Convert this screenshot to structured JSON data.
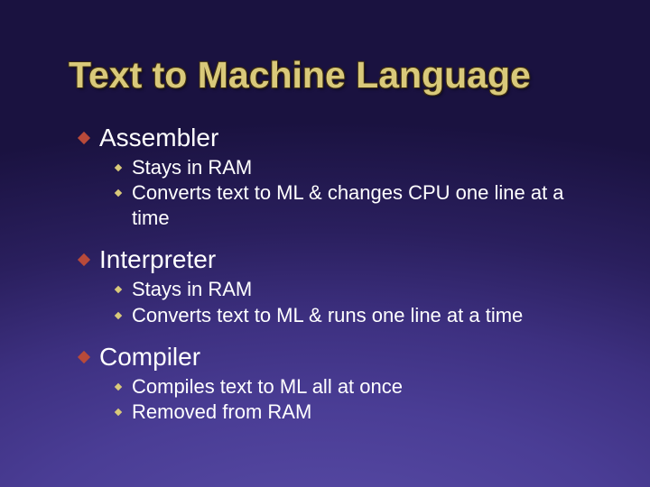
{
  "title": "Text to Machine Language",
  "items": [
    {
      "label": "Assembler",
      "subs": [
        "Stays in RAM",
        "Converts text to ML & changes CPU one line at a time"
      ]
    },
    {
      "label": "Interpreter",
      "subs": [
        "Stays in RAM",
        "Converts text to ML & runs one line at a time"
      ]
    },
    {
      "label": "Compiler",
      "subs": [
        "Compiles text to ML all at once",
        "Removed from RAM"
      ]
    }
  ]
}
